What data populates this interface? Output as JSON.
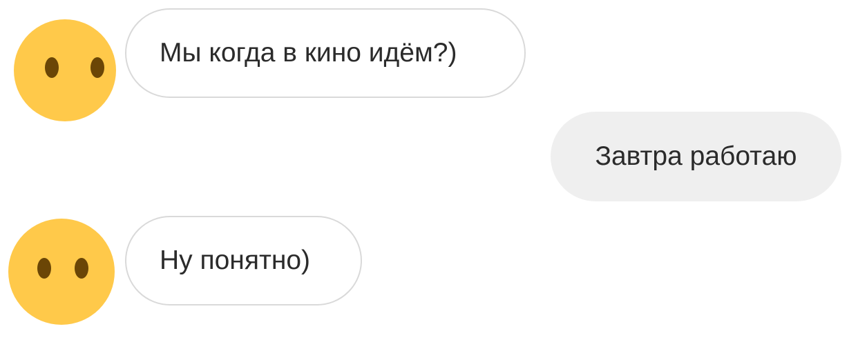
{
  "colors": {
    "avatar_face": "#ffc94a",
    "avatar_eyes": "#6b4606",
    "incoming_bubble_bg": "#ffffff",
    "incoming_bubble_border": "#d9d9d9",
    "outgoing_bubble_bg": "#efefef",
    "text": "#2b2b2b"
  },
  "messages": [
    {
      "direction": "incoming",
      "avatar_icon": "face-without-mouth-emoji",
      "text": "Мы когда в кино идём?)"
    },
    {
      "direction": "outgoing",
      "text": "Завтра работаю"
    },
    {
      "direction": "incoming",
      "avatar_icon": "face-without-mouth-emoji",
      "text": "Ну понятно)"
    }
  ]
}
